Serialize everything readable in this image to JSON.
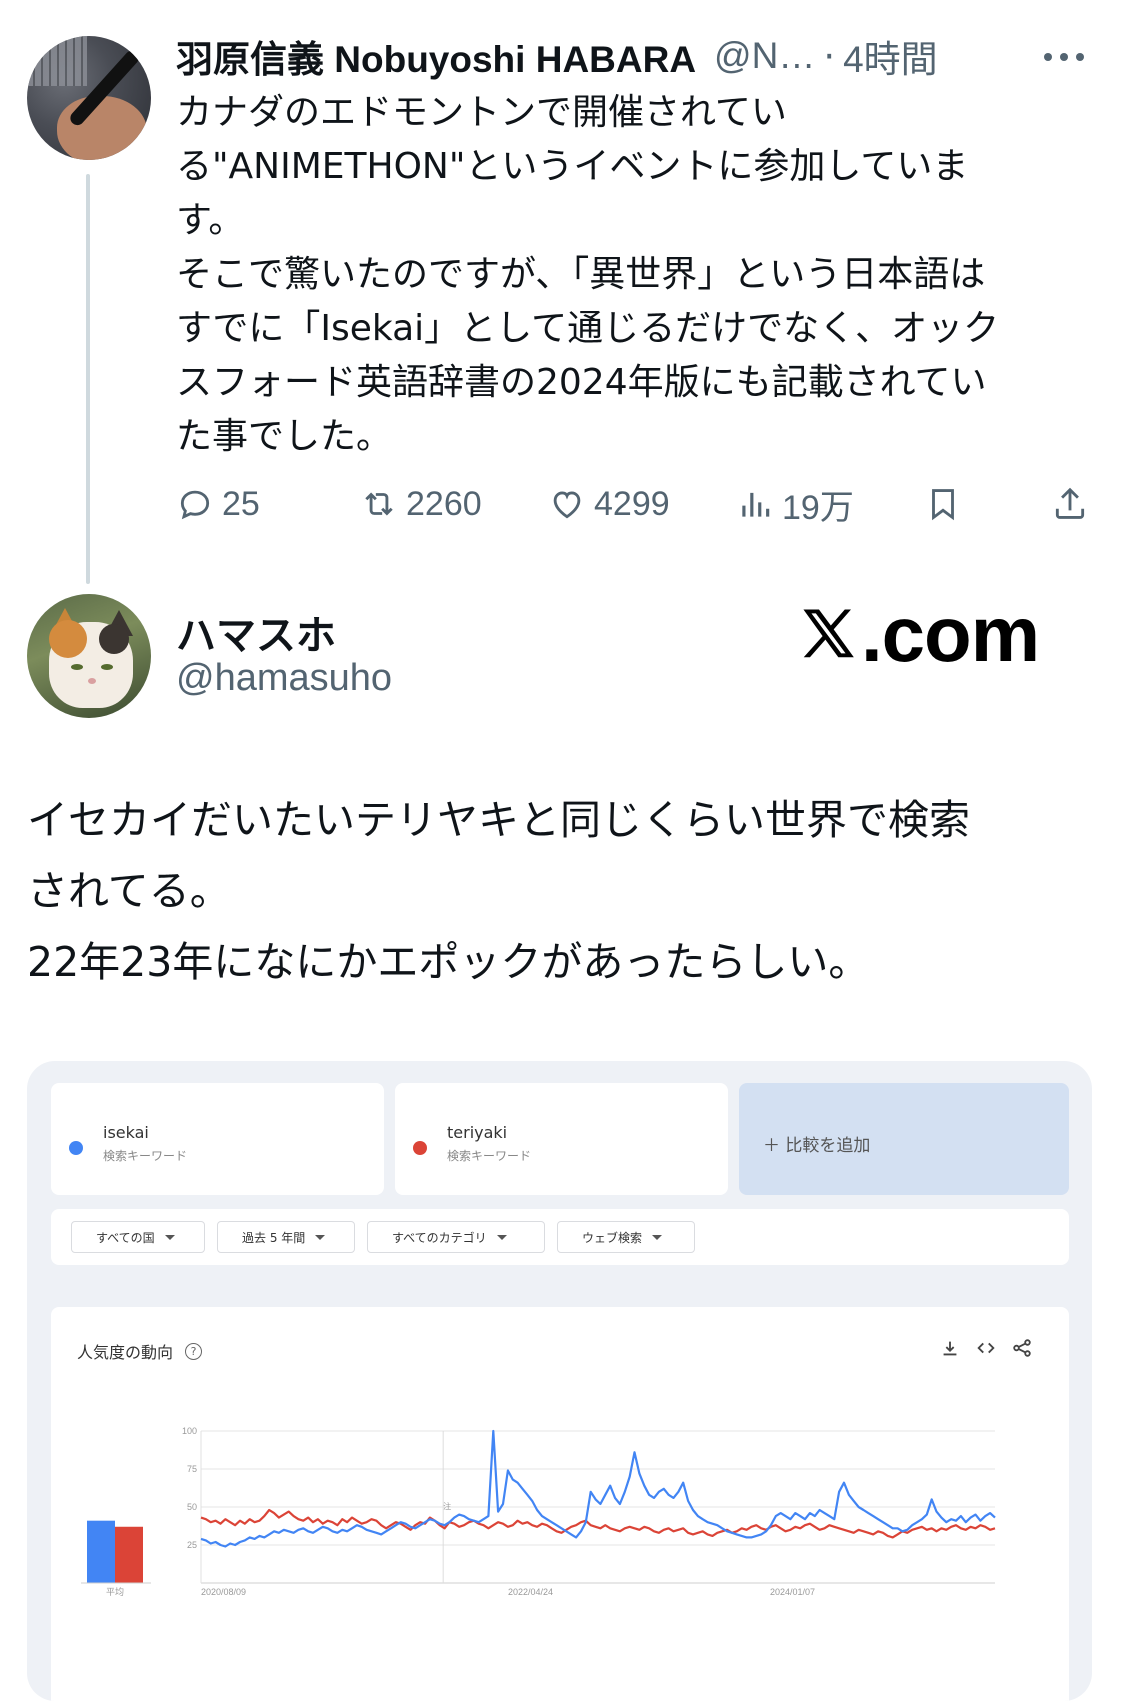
{
  "tweet1": {
    "author_name": "羽原信義 Nobuyoshi HABARA",
    "handle": "@N…",
    "separator": "·",
    "time": "4時間",
    "body_lines": [
      "カナダのエドモントンで開催されてい",
      "る\"ANIMETHON\"というイベントに参加していま",
      "す。",
      "そこで驚いたのですが、「異世界」という日本語は",
      "すでに「Isekai」として通じるだけでなく、オック",
      "スフォード英語辞書の2024年版にも記載されてい",
      "た事でした。"
    ],
    "actions": {
      "replies": "25",
      "reposts": "2260",
      "likes": "4299",
      "views": "19万"
    }
  },
  "tweet2": {
    "author_name": "ハマスホ",
    "handle": "@hamasuho",
    "watermark": ".com",
    "body_lines": [
      "イセカイだいたいテリヤキと同じくらい世界で検索",
      "されてる。",
      "22年23年になにかエポックがあったらしい。"
    ]
  },
  "trends": {
    "keywords": [
      {
        "name": "isekai",
        "sub": "検索キーワード",
        "color": "#4285f4"
      },
      {
        "name": "teriyaki",
        "sub": "検索キーワード",
        "color": "#db4437"
      }
    ],
    "add_compare": "＋ 比較を追加",
    "filters": [
      "すべての国",
      "過去 5 年間",
      "すべてのカテゴリ",
      "ウェブ検索"
    ],
    "chart_title": "人気度の動向",
    "help_glyph": "?",
    "note_marker": "注"
  },
  "chart_data": {
    "type": "line",
    "title": "人気度の動向",
    "ylim": [
      0,
      100
    ],
    "yticks": [
      "100",
      "75",
      "50",
      "25"
    ],
    "x_tick_labels": [
      "2020/08/09",
      "2022/04/24",
      "2024/01/07"
    ],
    "average_label": "平均",
    "series": [
      {
        "name": "isekai",
        "color": "#4285f4",
        "average": 41,
        "values": [
          29,
          28,
          26,
          27,
          25,
          24,
          26,
          25,
          27,
          28,
          30,
          29,
          31,
          30,
          32,
          34,
          33,
          35,
          34,
          33,
          35,
          36,
          34,
          33,
          35,
          37,
          36,
          34,
          33,
          35,
          34,
          36,
          38,
          37,
          35,
          34,
          33,
          32,
          34,
          36,
          38,
          40,
          39,
          37,
          36,
          38,
          40,
          42,
          41,
          39,
          38,
          40,
          43,
          45,
          44,
          42,
          41,
          40,
          42,
          44,
          100,
          47,
          52,
          74,
          68,
          66,
          62,
          58,
          54,
          48,
          44,
          42,
          40,
          38,
          36,
          34,
          32,
          30,
          34,
          40,
          60,
          55,
          52,
          58,
          64,
          56,
          52,
          60,
          70,
          86,
          72,
          64,
          58,
          56,
          60,
          62,
          58,
          56,
          60,
          66,
          54,
          48,
          44,
          42,
          40,
          39,
          38,
          36,
          34,
          33,
          32,
          31,
          30,
          30,
          31,
          32,
          34,
          38,
          44,
          46,
          44,
          42,
          46,
          44,
          42,
          46,
          44,
          48,
          46,
          44,
          42,
          60,
          66,
          58,
          54,
          50,
          48,
          46,
          44,
          42,
          40,
          38,
          36,
          36,
          34,
          35,
          38,
          40,
          42,
          45,
          55,
          47,
          43,
          40,
          42,
          41,
          44,
          40,
          43,
          45,
          41,
          44,
          46,
          43
        ]
      },
      {
        "name": "teriyaki",
        "color": "#db4437",
        "average": 37,
        "values": [
          43,
          42,
          40,
          41,
          39,
          42,
          40,
          38,
          41,
          39,
          42,
          40,
          41,
          44,
          48,
          46,
          43,
          45,
          47,
          44,
          42,
          41,
          43,
          40,
          42,
          39,
          41,
          40,
          38,
          42,
          40,
          43,
          41,
          39,
          40,
          42,
          41,
          38,
          36,
          38,
          40,
          39,
          37,
          35,
          38,
          40,
          39,
          43,
          41,
          38,
          36,
          40,
          39,
          37,
          38,
          40,
          41,
          39,
          38,
          36,
          38,
          40,
          39,
          37,
          38,
          41,
          39,
          40,
          38,
          37,
          39,
          38,
          36,
          34,
          33,
          35,
          37,
          38,
          40,
          41,
          38,
          37,
          36,
          38,
          36,
          35,
          34,
          36,
          37,
          36,
          35,
          37,
          36,
          34,
          33,
          35,
          36,
          34,
          35,
          36,
          33,
          32,
          33,
          34,
          32,
          31,
          33,
          34,
          35,
          33,
          34,
          36,
          35,
          37,
          38,
          36,
          35,
          37,
          38,
          36,
          34,
          35,
          37,
          36,
          38,
          39,
          37,
          35,
          36,
          38,
          37,
          36,
          35,
          34,
          33,
          35,
          34,
          33,
          32,
          34,
          33,
          31,
          30,
          32,
          34,
          33,
          35,
          36,
          37,
          35,
          36,
          34,
          36,
          35,
          37,
          38,
          36,
          35,
          37,
          36,
          38,
          37,
          35,
          36
        ]
      }
    ]
  },
  "colors": {
    "text_primary": "#0f1419",
    "text_secondary": "#536471",
    "isekai": "#4285f4",
    "teriyaki": "#db4437"
  }
}
